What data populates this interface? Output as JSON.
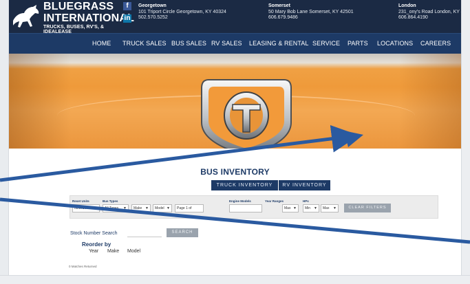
{
  "logo": {
    "line1": "BLUEGRASS",
    "line2": "INTERNATIONAL",
    "tagline": "TRUCKS, BUSES, RV'S, & IDEALEASE"
  },
  "social": {
    "facebook": "f",
    "linkedin": "in"
  },
  "locations": [
    {
      "name": "Georgetown",
      "address": "101 Triport Circle Georgetown, KY 40324",
      "phone": "502.570.5252"
    },
    {
      "name": "Somerset",
      "address": "50 Mary Bob Lane Somerset, KY 42501",
      "phone": "606.679.9486"
    },
    {
      "name": "London",
      "address": "231_ony's Road London, KY 40",
      "phone": "606.864.4190"
    }
  ],
  "nav": [
    "HOME",
    "TRUCK SALES",
    "BUS SALES",
    "RV SALES",
    "LEASING & RENTAL",
    "SERVICE",
    "PARTS",
    "LOCATIONS",
    "CAREERS"
  ],
  "inventory": {
    "title": "BUS INVENTORY",
    "buttons": [
      "TRUCK INVENTORY",
      "RV INVENTORY"
    ]
  },
  "filters": [
    {
      "label": "Reset Units",
      "value": "New/Used"
    },
    {
      "label": "Bus Types",
      "value": "All Types"
    },
    {
      "label": "",
      "value": "Make"
    },
    {
      "label": "",
      "value": "Model"
    },
    {
      "label": "",
      "value": "Page 1 of"
    },
    {
      "label": "Engine Models",
      "value": ""
    },
    {
      "label": "Year Ranges",
      "value": "Max"
    },
    {
      "label": "HPs",
      "value": "Min"
    },
    {
      "label": "",
      "value": "Max"
    }
  ],
  "clear_filters": "CLEAR FILTERS",
  "stock_search": {
    "label": "Stock Number Search",
    "button": "SEARCH"
  },
  "reorder": {
    "label": "Reorder by",
    "options": [
      "Year",
      "Make",
      "Model"
    ]
  },
  "matches_text": "0 Matches Returned",
  "colors": {
    "header_bg": "#1b2a44",
    "nav_bg": "#1d3a66",
    "hero_orange": "#ef9a3a",
    "arrow_blue": "#2a5aa0",
    "button_gray": "#9aa3ad"
  }
}
